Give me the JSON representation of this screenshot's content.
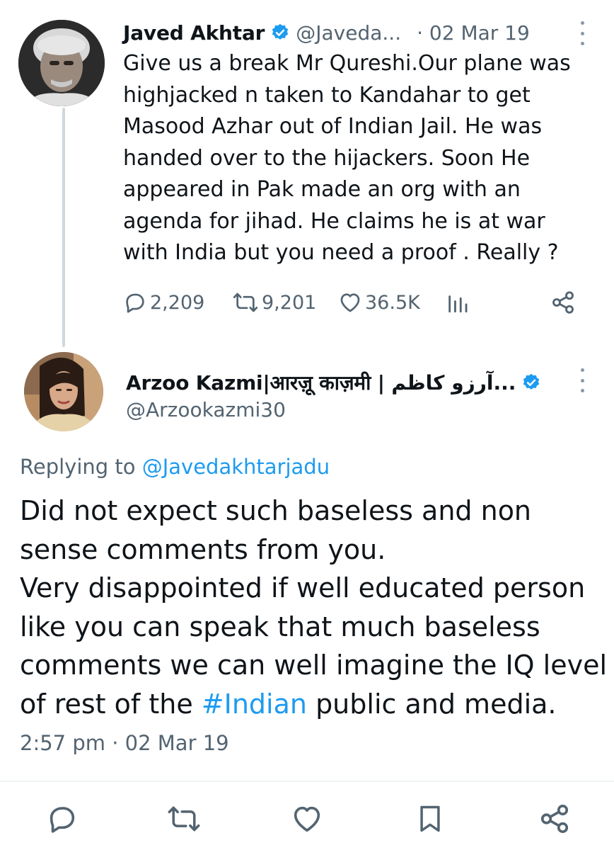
{
  "tweet1": {
    "author_name": "Javed Akhtar",
    "handle": "@Javeda...",
    "date": "· 02 Mar 19",
    "lines": [
      "Give us a break Mr Qureshi.Our plane was",
      "highjacked n  taken to Kandahar to get",
      "Masood Azhar out of Indian Jail. He was",
      "handed over to the hijackers. Soon He",
      "appeared in Pak made an org with an",
      "agenda for jihad. He claims he is at war",
      "with India but you need a proof . Really ?"
    ],
    "replies": "2,209",
    "retweets": "9,201",
    "likes": "36.5K",
    "icons": {
      "reply": "reply-icon",
      "retweet": "retweet-icon",
      "like": "heart-icon",
      "views": "analytics-icon",
      "share": "share-icon",
      "verified": "verified-badge-icon",
      "more": "more-options-icon"
    }
  },
  "tweet2": {
    "author_name": "Arzoo Kazmi|आरज़ू काज़मी | آرزو کاظم...",
    "handle": "@Arzookazmi30",
    "replying_prefix": "Replying to ",
    "replying_to": "@Javedakhtarjadu",
    "lines": [
      "Did not expect such baseless and non",
      "sense comments from you.",
      "Very disappointed if well educated person",
      "like you can speak that much baseless",
      "comments we can well imagine the IQ level"
    ],
    "last_line_prefix": "of rest of the ",
    "hashtag": "#Indian",
    "last_line_suffix": " public and media.",
    "timestamp": "2:57 pm · 02 Mar 19",
    "icons": {
      "reply": "reply-icon",
      "retweet": "retweet-icon",
      "like": "heart-icon",
      "bookmark": "bookmark-icon",
      "share": "share-icon"
    }
  },
  "colors": {
    "accent": "#1d9bf0",
    "text": "#0f1419",
    "secondary": "#536471",
    "thread_line": "#cfd9de"
  }
}
